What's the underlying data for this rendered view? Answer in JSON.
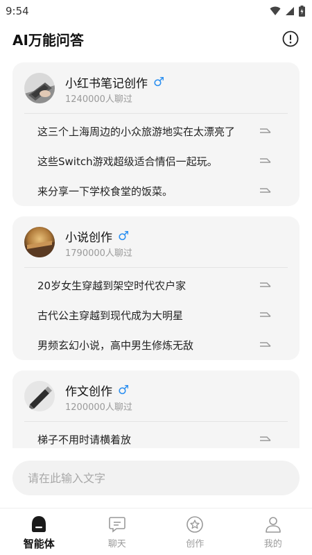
{
  "status_bar": {
    "time": "9:54"
  },
  "header": {
    "title": "AI万能问答"
  },
  "cards": [
    {
      "title": "小红书笔记创作",
      "gender_symbol": "♂",
      "count": "1240000人聊过",
      "questions": [
        "这三个上海周边的小众旅游地实在太漂亮了",
        "这些Switch游戏超级适合情侣一起玩。",
        "来分享一下学校食堂的饭菜。"
      ]
    },
    {
      "title": "小说创作",
      "gender_symbol": "♂",
      "count": "1790000人聊过",
      "questions": [
        "20岁女生穿越到架空时代农户家",
        "古代公主穿越到现代成为大明星",
        "男频玄幻小说，高中男生修炼无敌"
      ]
    },
    {
      "title": "作文创作",
      "gender_symbol": "♂",
      "count": "1200000人聊过",
      "questions": [
        "梯子不用时请横着放"
      ]
    }
  ],
  "input": {
    "placeholder": "请在此输入文字"
  },
  "tabs": [
    {
      "label": "智能体",
      "icon": "agent-icon",
      "active": true
    },
    {
      "label": "聊天",
      "icon": "chat-icon",
      "active": false
    },
    {
      "label": "创作",
      "icon": "create-icon",
      "active": false
    },
    {
      "label": "我的",
      "icon": "profile-icon",
      "active": false
    }
  ],
  "colors": {
    "accent_blue": "#2b8ff0",
    "card_bg": "#f5f5f5",
    "muted_text": "#9a9a9a"
  }
}
